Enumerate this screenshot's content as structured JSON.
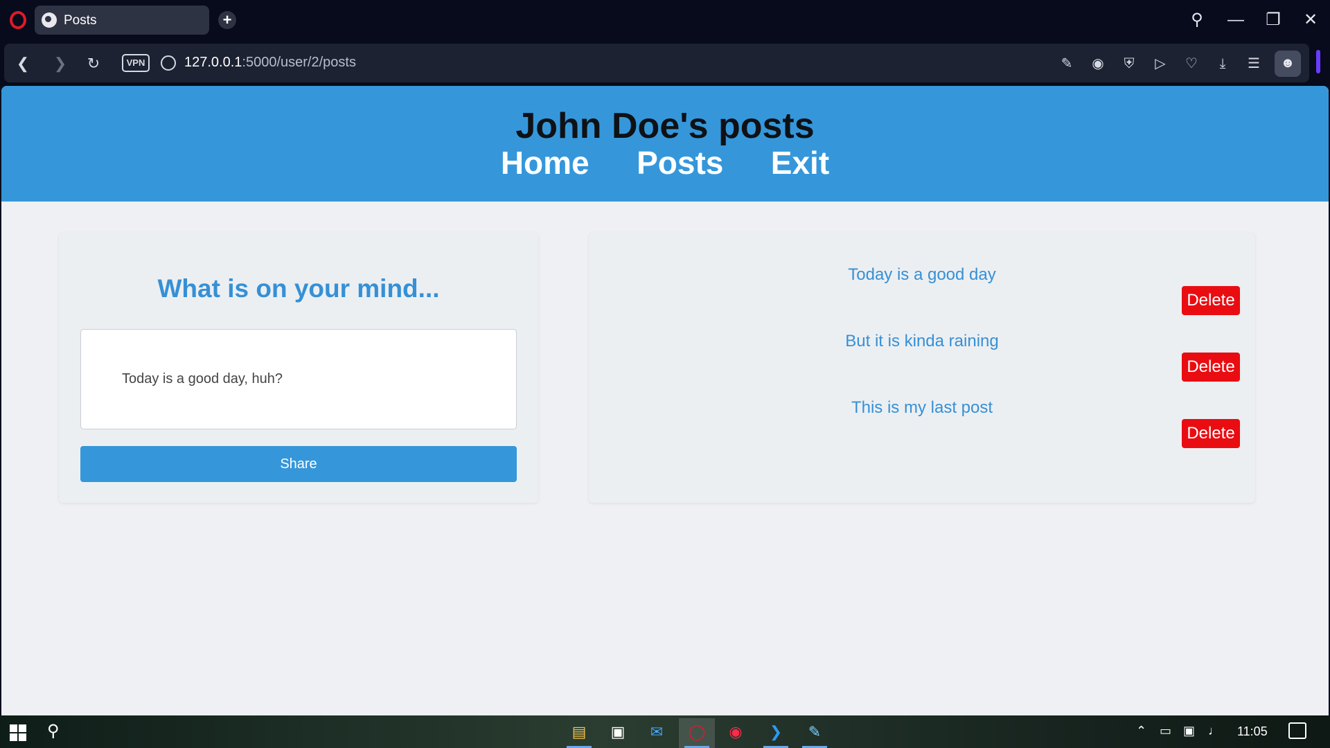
{
  "browser": {
    "tab_title": "Posts",
    "url_host": "127.0.0.1",
    "url_path": ":5000/user/2/posts",
    "vpn_label": "VPN"
  },
  "page": {
    "header_title": "John Doe's posts",
    "nav": [
      "Home",
      "Posts",
      "Exit"
    ],
    "composer": {
      "title": "What is on your mind...",
      "input_value": "Today is a good day, huh?",
      "share_label": "Share"
    },
    "posts": [
      {
        "text": "Today is a good day",
        "delete_label": "Delete"
      },
      {
        "text": "But it is kinda raining",
        "delete_label": "Delete"
      },
      {
        "text": "This is my last post",
        "delete_label": "Delete"
      }
    ]
  },
  "taskbar": {
    "time": "11:05"
  },
  "colors": {
    "header_bg": "#3597da",
    "accent_text": "#3590d6",
    "delete_bg": "#e90d12"
  }
}
